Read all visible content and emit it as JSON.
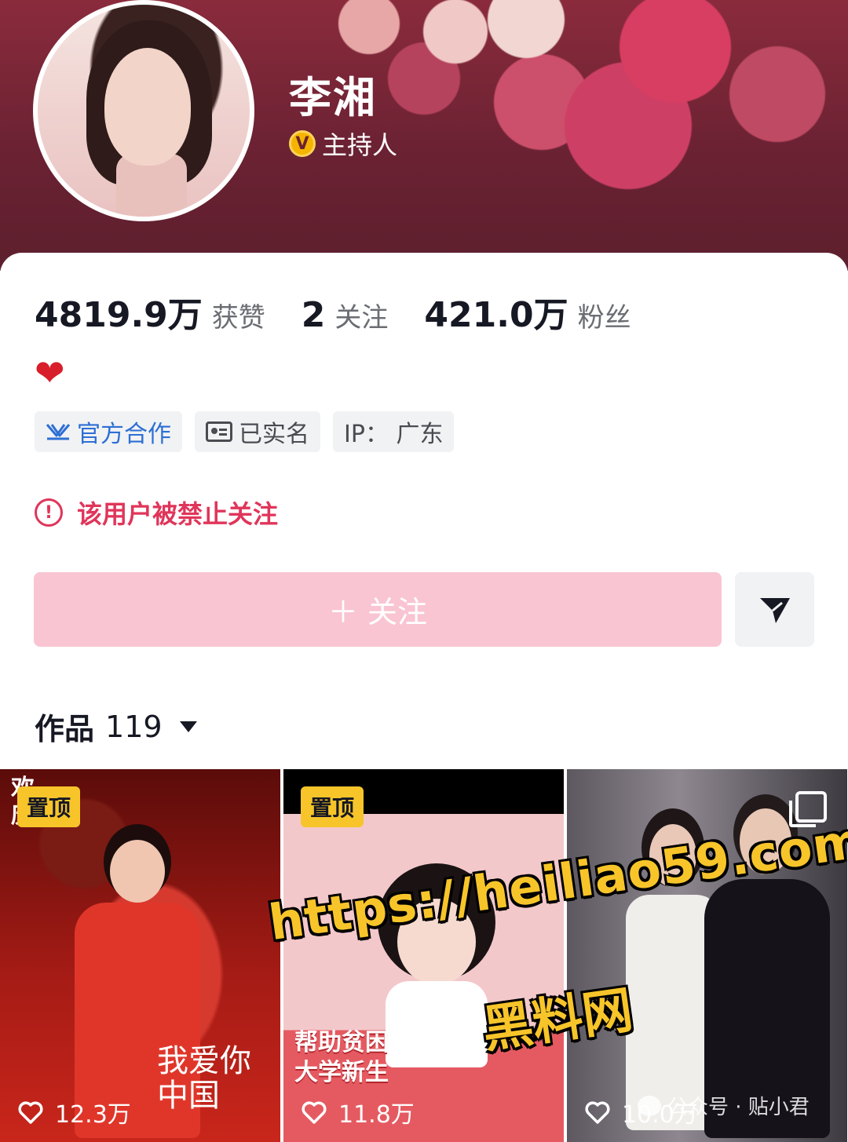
{
  "profile": {
    "name": "李湘",
    "verify_mark": "V",
    "verify_label": "主持人"
  },
  "stats": [
    {
      "value": "4819.9万",
      "label": "获赞"
    },
    {
      "value": "2",
      "label": "关注"
    },
    {
      "value": "421.0万",
      "label": "粉丝"
    }
  ],
  "bio_emoji": "❤",
  "tags": {
    "official": "官方合作",
    "verified": "已实名",
    "ip": "IP：  广东"
  },
  "warning": {
    "icon": "!",
    "text": "该用户被禁止关注"
  },
  "actions": {
    "follow_label": "＋ 关注"
  },
  "works": {
    "label": "作品",
    "count": "119"
  },
  "videos": [
    {
      "pinned": "置顶",
      "likes": "12.3万",
      "corner_text": "欢\n庆",
      "caption": "我爱你\n中国"
    },
    {
      "pinned": "置顶",
      "likes": "11.8万",
      "caption": "帮助贫困\n大学新生"
    },
    {
      "likes": "10.0万"
    }
  ],
  "watermark": {
    "url": "https://heiliao59.com",
    "name": "黑料网",
    "credit": "公众号 · 贴小君"
  },
  "colors": {
    "accent": "#e0355a",
    "follow_button": "#f9c5d2",
    "pin_badge": "#f7c52a",
    "official_blue": "#2d6fd4"
  }
}
